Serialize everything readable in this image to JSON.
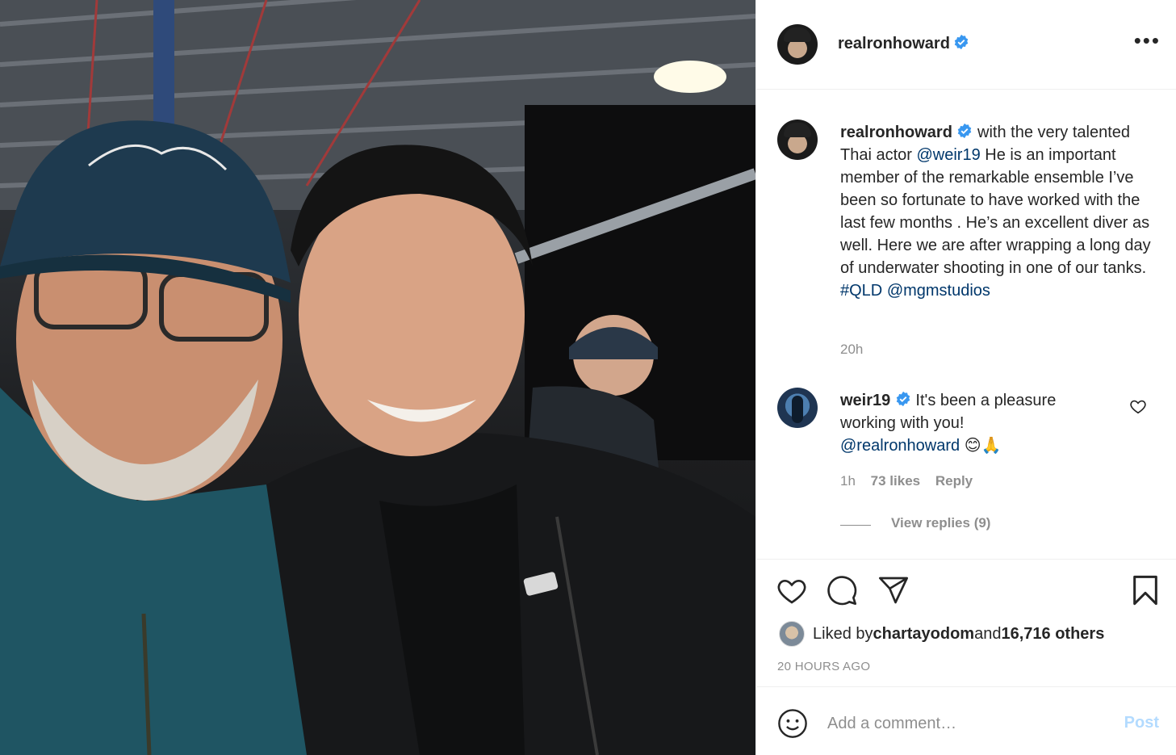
{
  "post": {
    "author": "realronhoward",
    "author_verified": true,
    "more_icon": "more-horizontal-icon"
  },
  "caption": {
    "author": "realronhoward",
    "text_1": " with the very talented Thai actor ",
    "mention_1": "@weir19",
    "text_2": " He is an important member of the remarkable ensemble I’ve been so fortunate to have worked with the last few months . He’s an excellent diver as well. Here we are after wrapping a long day of underwater shooting in one of our tanks. ",
    "hashtag": "#QLD",
    "mention_2": "@mgmstudios",
    "time": "20h"
  },
  "comment": {
    "author": "weir19",
    "text": " It's been a pleasure working with you!",
    "mention": "@realronhoward",
    "emoji": "😊🙏",
    "time": "1h",
    "likes": "73 likes",
    "reply_label": "Reply",
    "view_replies": "View replies (9)"
  },
  "likes": {
    "prefix": "Liked by ",
    "user": "chartayodom",
    "middle": " and ",
    "count": "16,716 others",
    "ago": "20 HOURS AGO"
  },
  "add_comment": {
    "placeholder": "Add a comment…",
    "post_label": "Post"
  },
  "colors": {
    "verified": "#3897f0",
    "link": "#00376b",
    "muted": "#8e8e8e",
    "post_disabled": "#b3dbff"
  }
}
